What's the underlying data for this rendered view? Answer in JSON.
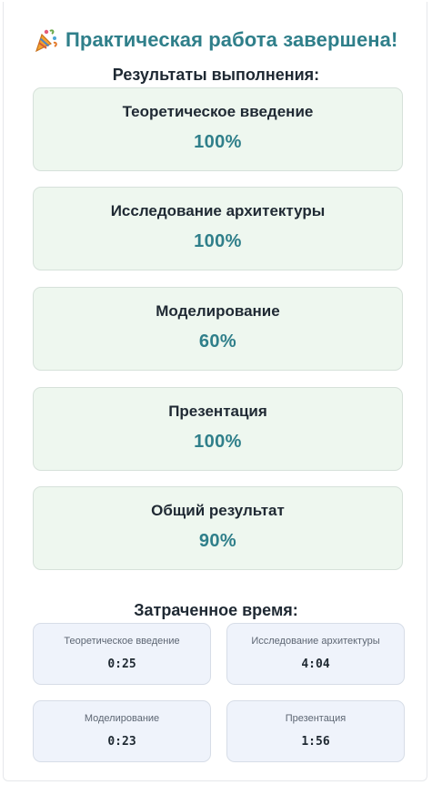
{
  "header": {
    "title": "Практическая работа завершена!",
    "icon": "party-popper-icon"
  },
  "results": {
    "section_title": "Результаты выполнения:",
    "items": [
      {
        "label": "Теоретическое введение",
        "value": "100%"
      },
      {
        "label": "Исследование архитектуры",
        "value": "100%"
      },
      {
        "label": "Моделирование",
        "value": "60%"
      },
      {
        "label": "Презентация",
        "value": "100%"
      },
      {
        "label": "Общий результат",
        "value": "90%"
      }
    ]
  },
  "time_spent": {
    "section_title": "Затраченное время:",
    "items": [
      {
        "label": "Теоретическое введение",
        "value": "0:25"
      },
      {
        "label": "Исследование архитектуры",
        "value": "4:04"
      },
      {
        "label": "Моделирование",
        "value": "0:23"
      },
      {
        "label": "Презентация",
        "value": "1:56"
      }
    ]
  },
  "colors": {
    "accent": "#2f7f8a",
    "result_card_background": "#eef7ef",
    "time_card_background": "#eff3fb",
    "text": "#1f2933"
  }
}
